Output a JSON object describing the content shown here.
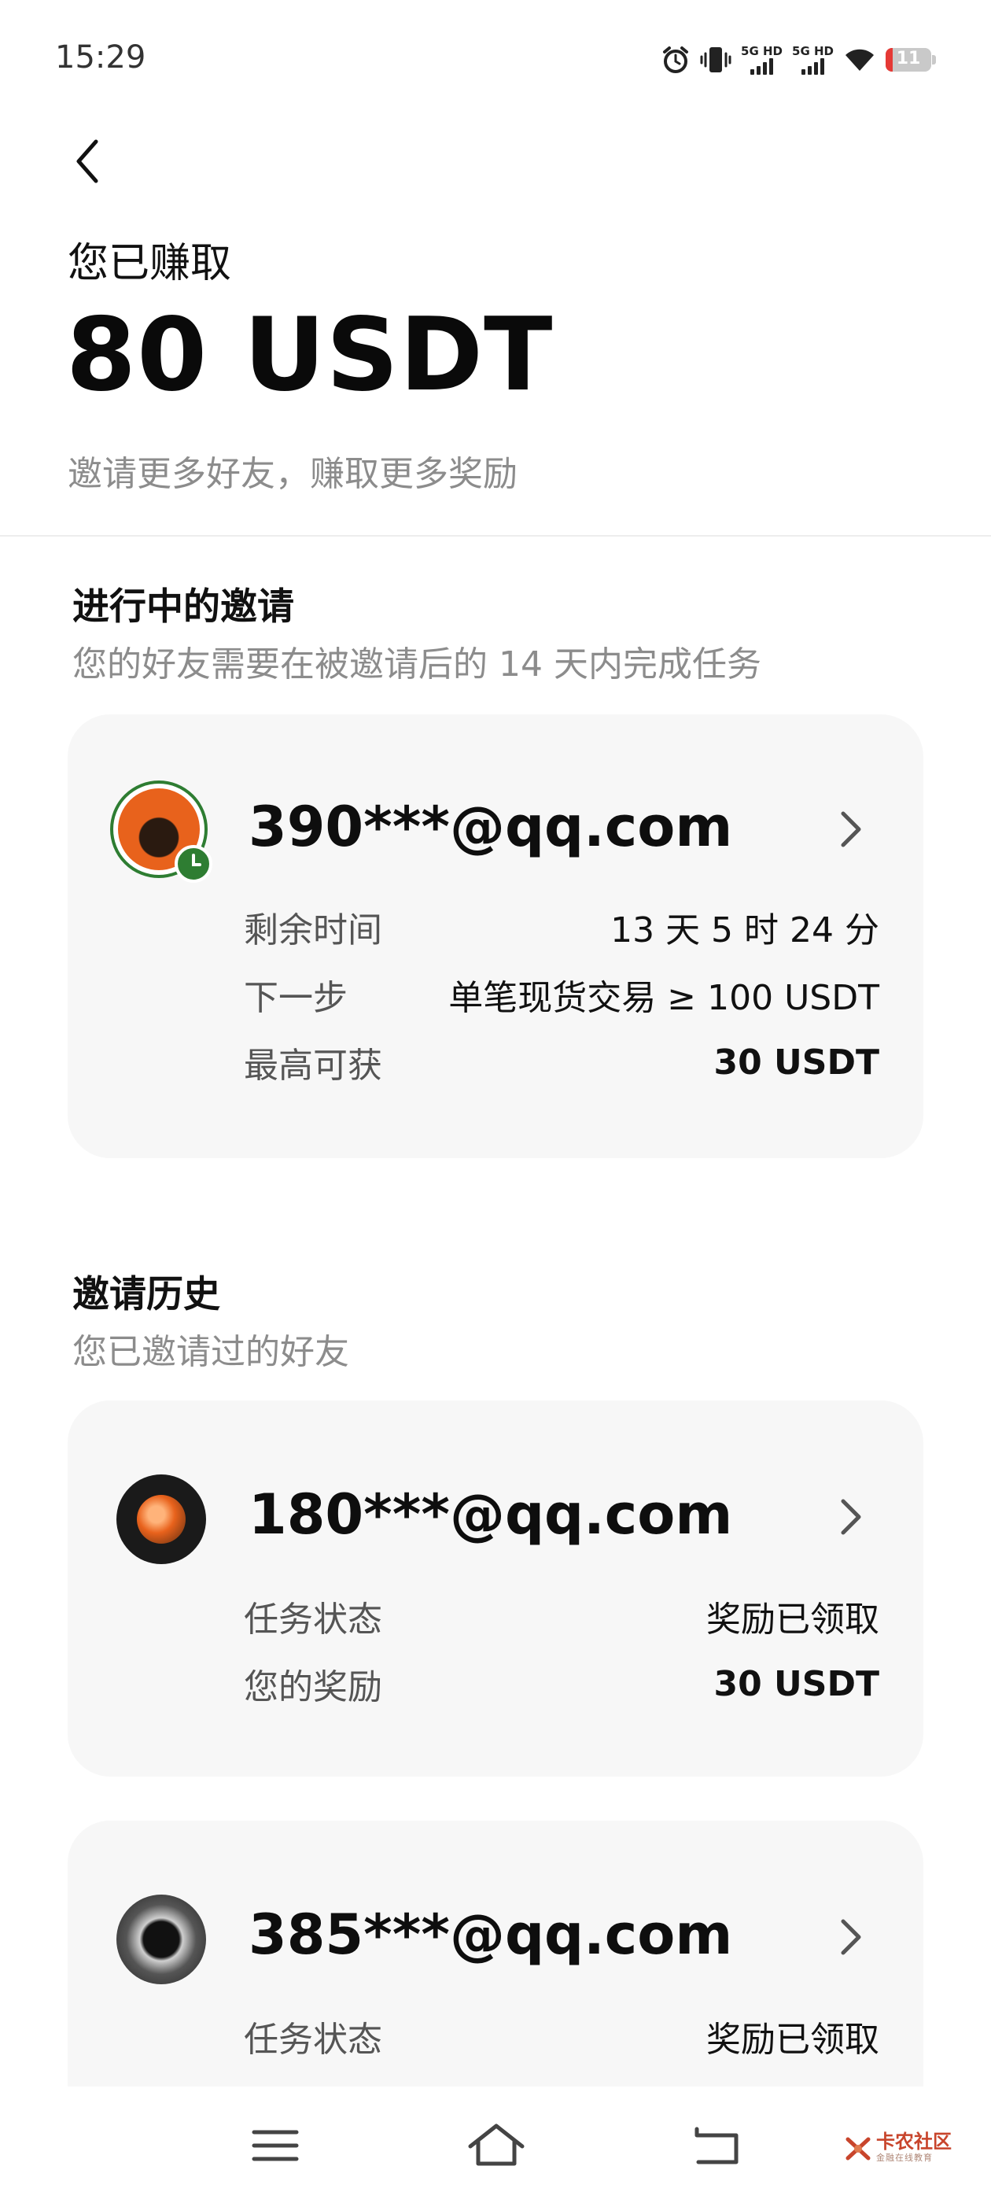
{
  "status_bar": {
    "time": "15:29",
    "sim1_label": "5G HD",
    "sim2_label": "5G HD",
    "battery": "11",
    "icons": [
      "alarm-icon",
      "vibrate-icon",
      "signal-icon",
      "signal-icon",
      "wifi-icon",
      "battery-icon"
    ]
  },
  "header": {
    "back_icon": "chevron-left-icon",
    "earned_label": "您已赚取",
    "earned_amount": "80 USDT",
    "subtitle": "邀请更多好友，赚取更多奖励"
  },
  "in_progress": {
    "title": "进行中的邀请",
    "subtitle": "您的好友需要在被邀请后的 14 天内完成任务",
    "card": {
      "email": "390***@qq.com",
      "rows": [
        {
          "key": "剩余时间",
          "value": "13 天 5 时 24 分"
        },
        {
          "key": "下一步",
          "value": "单笔现货交易 ≥ 100 USDT"
        },
        {
          "key": "最高可获",
          "value": "30 USDT"
        }
      ]
    }
  },
  "history": {
    "title": "邀请历史",
    "subtitle": "您已邀请过的好友",
    "cards": [
      {
        "email": "180***@qq.com",
        "rows": [
          {
            "key": "任务状态",
            "value": "奖励已领取"
          },
          {
            "key": "您的奖励",
            "value": "30 USDT"
          }
        ]
      },
      {
        "email": "385***@qq.com",
        "rows": [
          {
            "key": "任务状态",
            "value": "奖励已领取"
          }
        ]
      }
    ]
  },
  "navbar": {
    "icons": [
      "menu-icon",
      "home-icon",
      "back-icon"
    ],
    "watermark": "卡农社区",
    "watermark_sub": "金融在线教育"
  },
  "colors": {
    "accent_green": "#2e7d32",
    "avatar_orange": "#e8621c",
    "watermark_red": "#c8452c"
  }
}
